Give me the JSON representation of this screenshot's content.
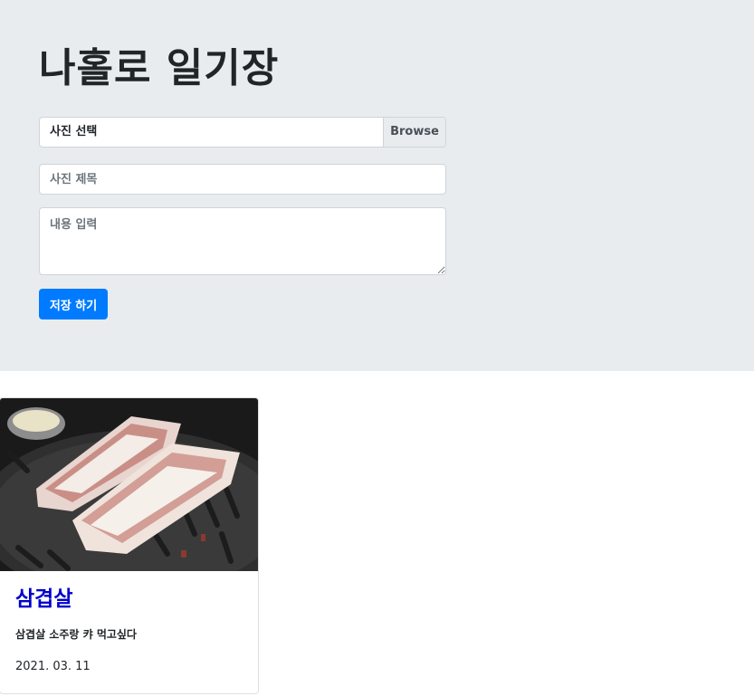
{
  "header": {
    "title": "나홀로 일기장"
  },
  "form": {
    "file_label": "사진 선택",
    "browse_label": "Browse",
    "title_placeholder": "사진 제목",
    "content_placeholder": "내용 입력",
    "save_label": "저장 하기"
  },
  "cards": [
    {
      "title": "삼겹살",
      "text": "삼겹살 소주랑 캬 먹고싶다",
      "date": "2021. 03. 11"
    }
  ],
  "colors": {
    "jumbotron_bg": "#e9ecef",
    "primary": "#007bff",
    "card_title": "#0000cc"
  }
}
